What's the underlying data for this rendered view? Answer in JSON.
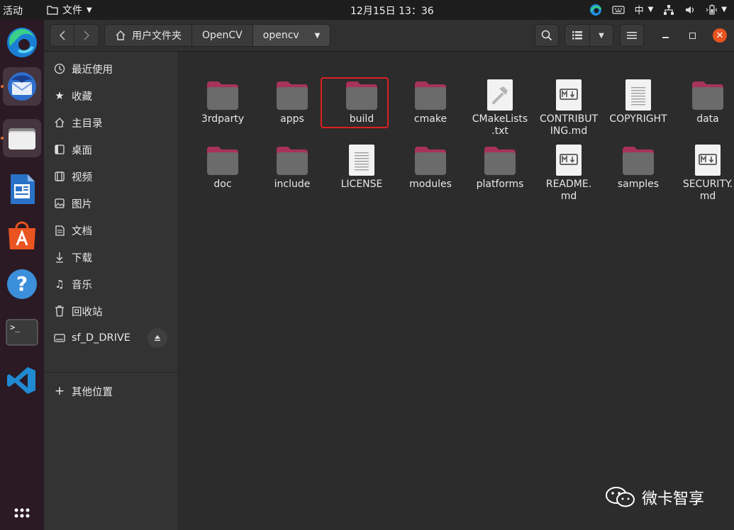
{
  "topbar": {
    "activities": "活动",
    "app_name": "文件",
    "clock": "12月15日  13：36",
    "input_method": "中"
  },
  "dock": {
    "apps": [
      "edge-icon",
      "thunderbird-icon",
      "files-icon",
      "writer-icon",
      "software-center-icon",
      "help-icon",
      "terminal-icon",
      "vscode-icon",
      "app-grid-icon"
    ]
  },
  "path": {
    "crumbs": [
      "用户文件夹",
      "OpenCV",
      "opencv"
    ]
  },
  "sidebar": {
    "items": [
      {
        "label": "最近使用",
        "icon": "clock-icon"
      },
      {
        "label": "收藏",
        "icon": "star-icon"
      },
      {
        "label": "主目录",
        "icon": "home-icon"
      },
      {
        "label": "桌面",
        "icon": "desktop-icon"
      },
      {
        "label": "视频",
        "icon": "video-icon"
      },
      {
        "label": "图片",
        "icon": "picture-icon"
      },
      {
        "label": "文档",
        "icon": "document-icon"
      },
      {
        "label": "下载",
        "icon": "download-icon"
      },
      {
        "label": "音乐",
        "icon": "music-icon"
      },
      {
        "label": "回收站",
        "icon": "trash-icon"
      },
      {
        "label": "sf_D_DRIVE",
        "icon": "drive-icon"
      },
      {
        "label": "其他位置",
        "icon": "plus-icon"
      }
    ]
  },
  "files": [
    {
      "name": "3rdparty",
      "type": "folder"
    },
    {
      "name": "apps",
      "type": "folder"
    },
    {
      "name": "build",
      "type": "folder"
    },
    {
      "name": "cmake",
      "type": "folder"
    },
    {
      "name": "CMakeLists.txt",
      "type": "cmake"
    },
    {
      "name": "CONTRIBUTING.md",
      "type": "md"
    },
    {
      "name": "COPYRIGHT",
      "type": "text"
    },
    {
      "name": "data",
      "type": "folder"
    },
    {
      "name": "doc",
      "type": "folder"
    },
    {
      "name": "include",
      "type": "folder"
    },
    {
      "name": "LICENSE",
      "type": "text"
    },
    {
      "name": "modules",
      "type": "folder"
    },
    {
      "name": "platforms",
      "type": "folder"
    },
    {
      "name": "README.md",
      "type": "md"
    },
    {
      "name": "samples",
      "type": "folder"
    },
    {
      "name": "SECURITY.md",
      "type": "md"
    }
  ],
  "file_name_lines": {
    "4": [
      "CMakeLists",
      ".txt"
    ],
    "5": [
      "CONTRIBUT",
      "ING.md"
    ],
    "13": [
      "README.",
      "md"
    ],
    "15": [
      "SECURITY.",
      "md"
    ]
  },
  "watermark": "微卡智享",
  "colors": {
    "accent": "#e95420",
    "folder_tab": "#a8335a",
    "folder_body": "#6b6b6b",
    "highlight": "#e02020"
  }
}
